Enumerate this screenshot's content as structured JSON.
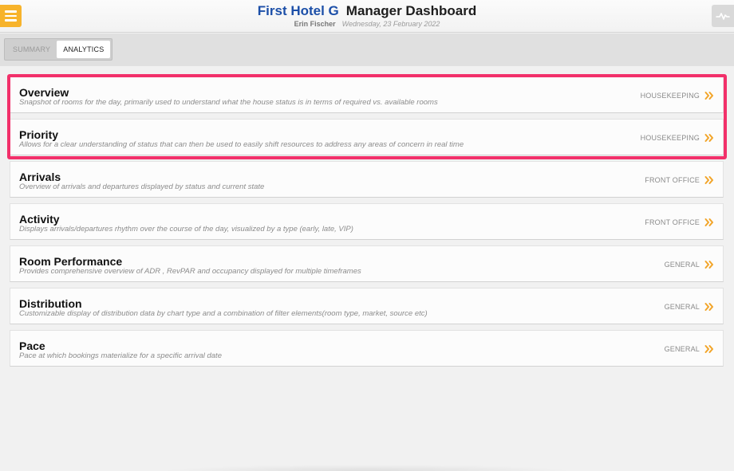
{
  "header": {
    "hotel_name": "First Hotel G",
    "dashboard_title": "Manager Dashboard",
    "user_name": "Erin Fischer",
    "date": "Wednesday, 23 February 2022",
    "menu_icon": "hamburger-menu-icon",
    "activity_icon": "pulse-icon"
  },
  "tabs": [
    {
      "label": "Summary",
      "active": false
    },
    {
      "label": "Analytics",
      "active": true
    }
  ],
  "colors": {
    "accent": "#f7b32b",
    "hotel_name": "#1c4fa8",
    "highlight": "#f2306a",
    "chevron": "#f2a52a"
  },
  "cards": [
    {
      "title": "Overview",
      "description": "Snapshot of rooms for the day, primarily used to understand what the house status is in terms of required vs. available rooms",
      "category": "Housekeeping"
    },
    {
      "title": "Priority",
      "description": "Allows for a clear understanding of status that can then be used to easily shift resources to address any areas of concern in real time",
      "category": "Housekeeping"
    },
    {
      "title": "Arrivals",
      "description": "Overview of arrivals and departures displayed by status and current state",
      "category": "Front Office"
    },
    {
      "title": "Activity",
      "description": "Displays arrivals/departures rhythm over the course of the day, visualized by a type (early, late, VIP)",
      "category": "Front Office"
    },
    {
      "title": "Room Performance",
      "description": "Provides comprehensive overview of ADR , RevPAR and occupancy displayed for multiple timeframes",
      "category": "General"
    },
    {
      "title": "Distribution",
      "description": "Customizable display of distribution data by chart type and a combination of filter elements(room type, market, source etc)",
      "category": "General"
    },
    {
      "title": "Pace",
      "description": "Pace at which bookings materialize for a specific arrival date",
      "category": "General"
    }
  ]
}
